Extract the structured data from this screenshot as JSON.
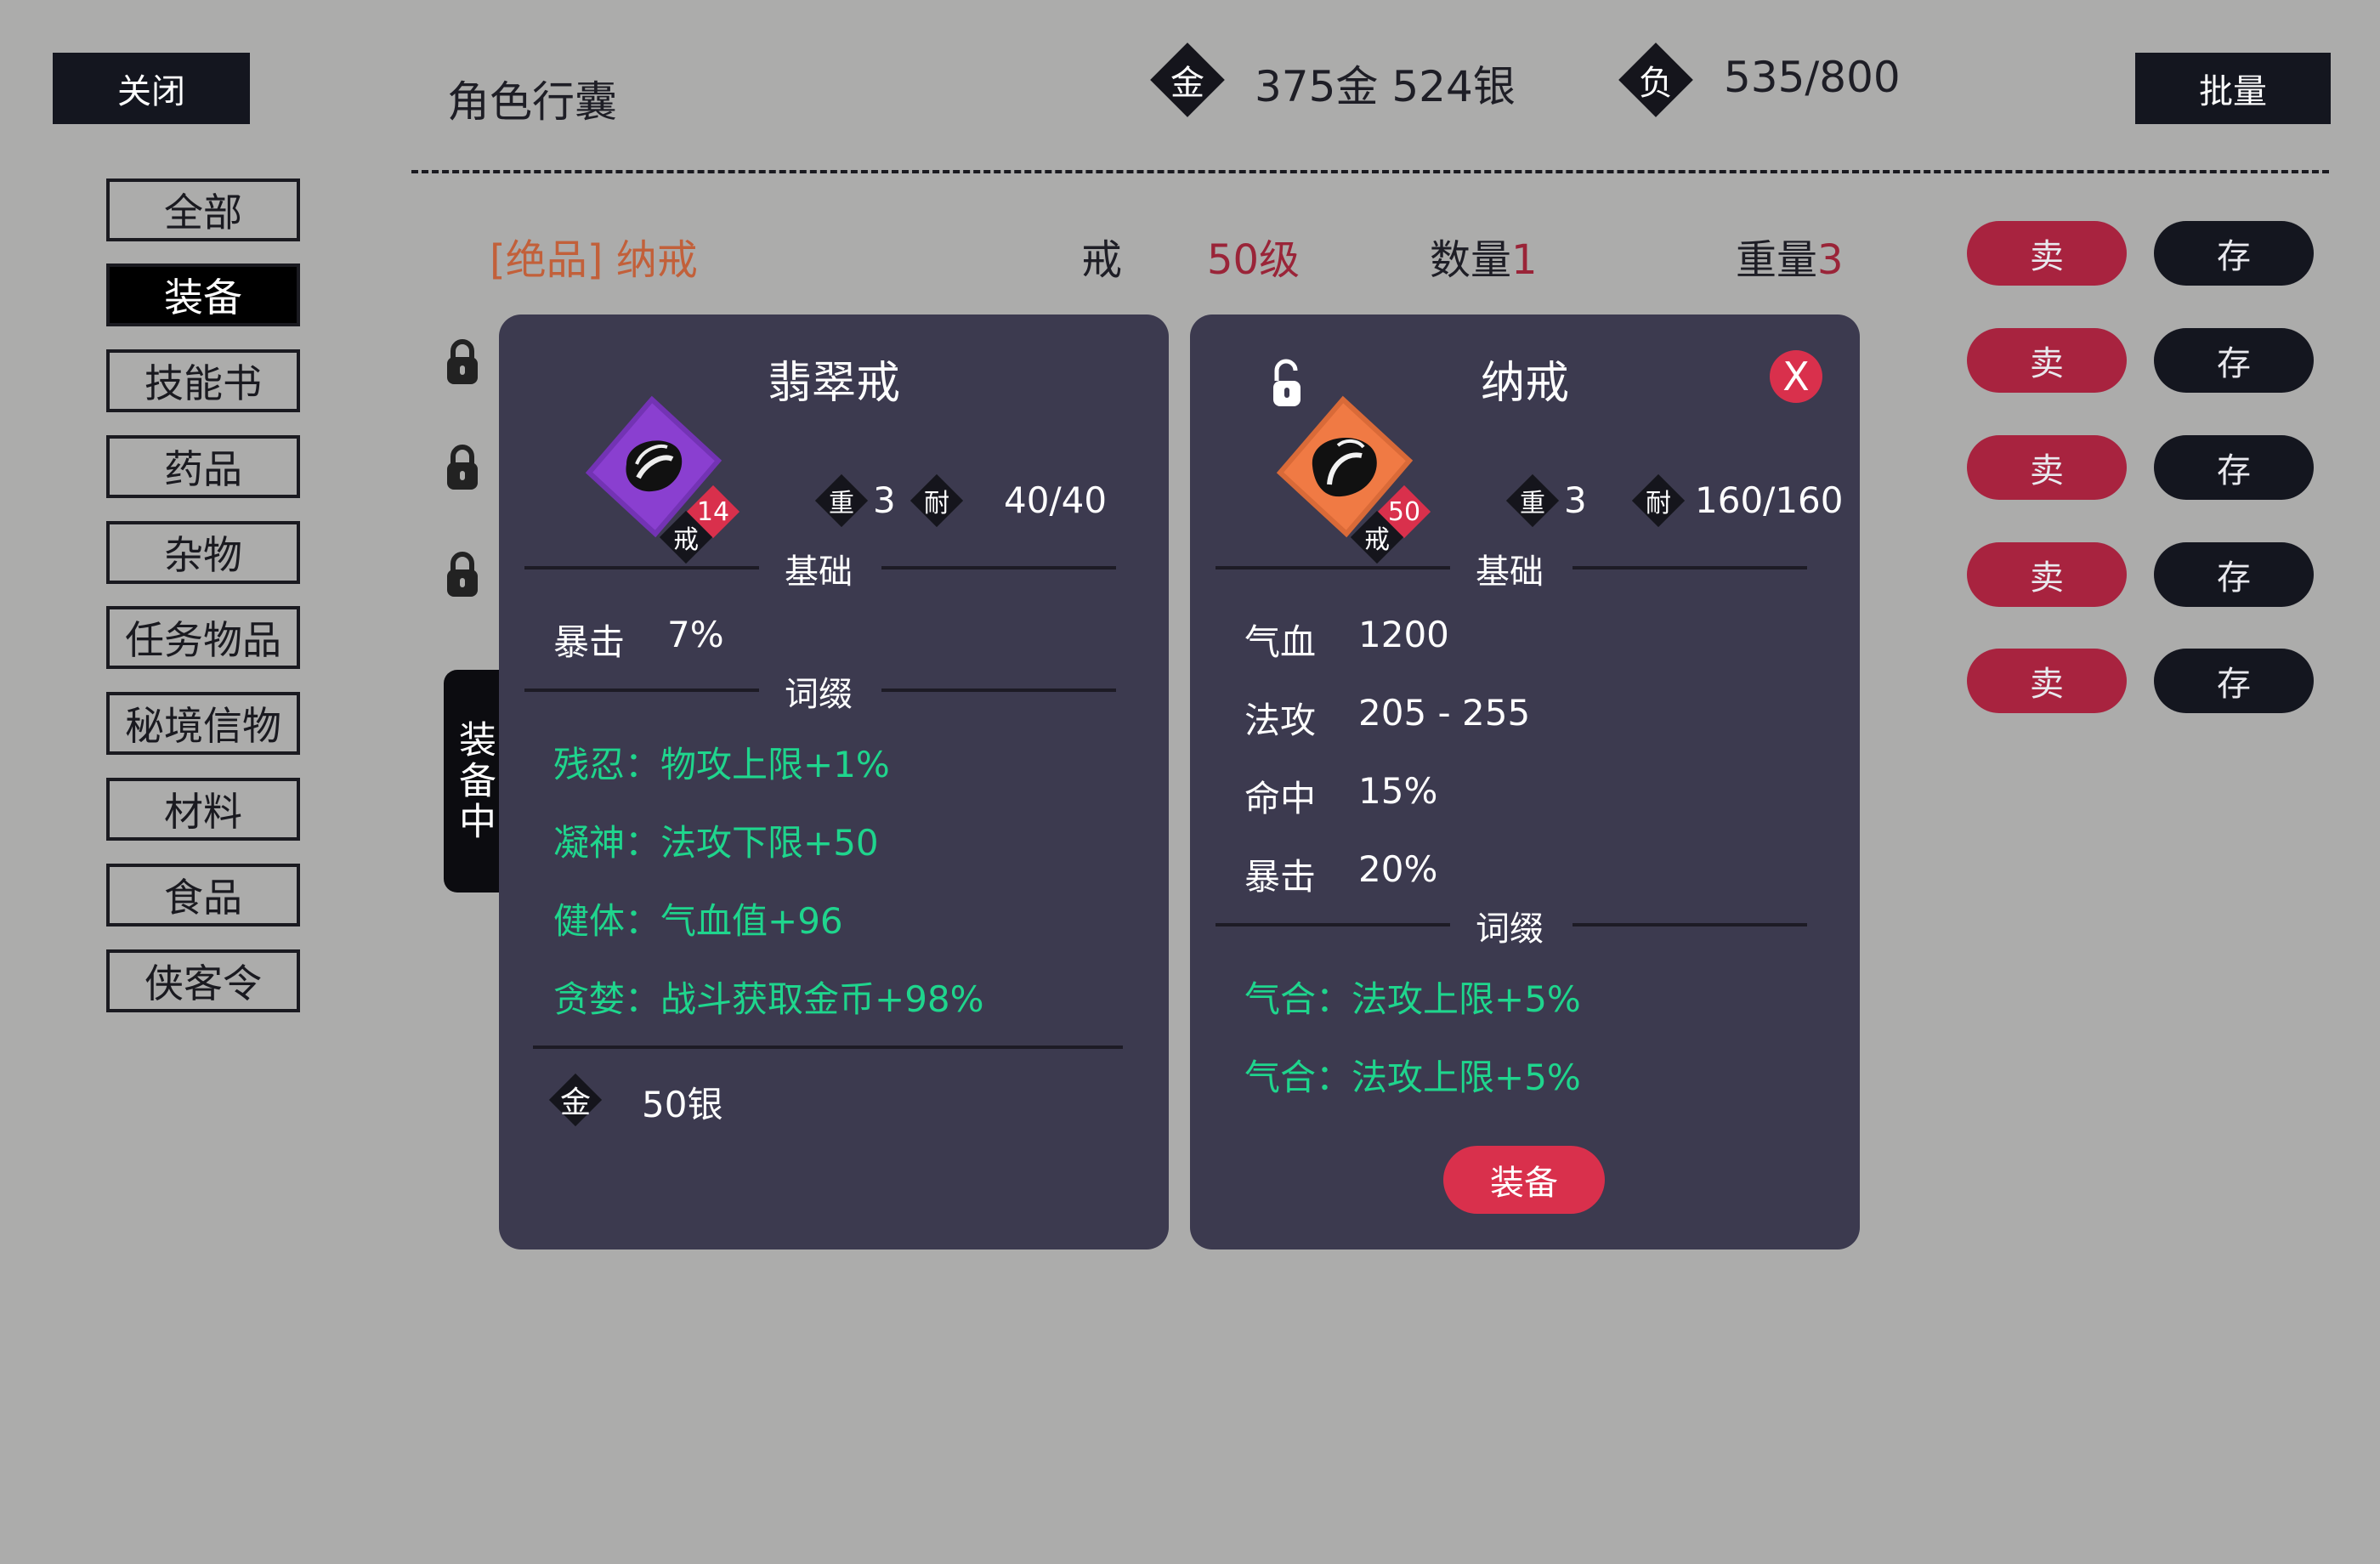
{
  "header": {
    "close_label": "关闭",
    "title": "角色行囊",
    "gold_icon_label": "金",
    "gold_text": "375金 524银",
    "weight_icon_label": "负",
    "weight_text": "535/800",
    "batch_label": "批量"
  },
  "sidebar": {
    "items": [
      {
        "label": "全部",
        "active": false
      },
      {
        "label": "装备",
        "active": true
      },
      {
        "label": "技能书",
        "active": false
      },
      {
        "label": "药品",
        "active": false
      },
      {
        "label": "杂物",
        "active": false
      },
      {
        "label": "任务物品",
        "active": false
      },
      {
        "label": "秘境信物",
        "active": false
      },
      {
        "label": "材料",
        "active": false
      },
      {
        "label": "食品",
        "active": false
      },
      {
        "label": "侠客令",
        "active": false
      }
    ]
  },
  "list": {
    "first_row": {
      "name": "[绝品] 纳戒",
      "type": "戒",
      "level": "50级",
      "qty_label": "数量",
      "qty": "1",
      "weight_label": "重量",
      "weight": "3"
    },
    "sell_label": "卖",
    "store_label": "存",
    "row_count": 5
  },
  "equipped_tab": {
    "label": "装备中"
  },
  "equipped_panel": {
    "name": "翡翠戒",
    "level_badge": "14",
    "type_badge": "戒",
    "weight_label": "重",
    "weight_value": "3",
    "durability_label": "耐",
    "durability_value": "40/40",
    "base_section": "基础",
    "base_stats": [
      {
        "label": "暴击",
        "value": "7%"
      }
    ],
    "affix_section": "词缀",
    "affixes": [
      "残忍：物攻上限+1%",
      "凝神：法攻下限+50",
      "健体：气血值+96",
      "贪婪：战斗获取金币+98%"
    ],
    "price_icon": "金",
    "price": "50银",
    "icon_color": "#8a3fd0"
  },
  "compare_panel": {
    "name": "纳戒",
    "close_label": "X",
    "level_badge": "50",
    "type_badge": "戒",
    "weight_label": "重",
    "weight_value": "3",
    "durability_label": "耐",
    "durability_value": "160/160",
    "base_section": "基础",
    "base_stats": [
      {
        "label": "气血",
        "value": "1200"
      },
      {
        "label": "法攻",
        "value": "205 - 255"
      },
      {
        "label": "命中",
        "value": "15%"
      },
      {
        "label": "暴击",
        "value": "20%"
      }
    ],
    "affix_section": "词缀",
    "affixes": [
      "气合：法攻上限+5%",
      "气合：法攻上限+5%"
    ],
    "equip_label": "装备",
    "icon_color": "#f07a44"
  },
  "colors": {
    "background": "#acacab",
    "panel": "#3c3a4f",
    "affix_green": "#1fd58d",
    "accent_red": "#d9304c",
    "sell_red": "#a8233f",
    "dark": "#14161f"
  }
}
